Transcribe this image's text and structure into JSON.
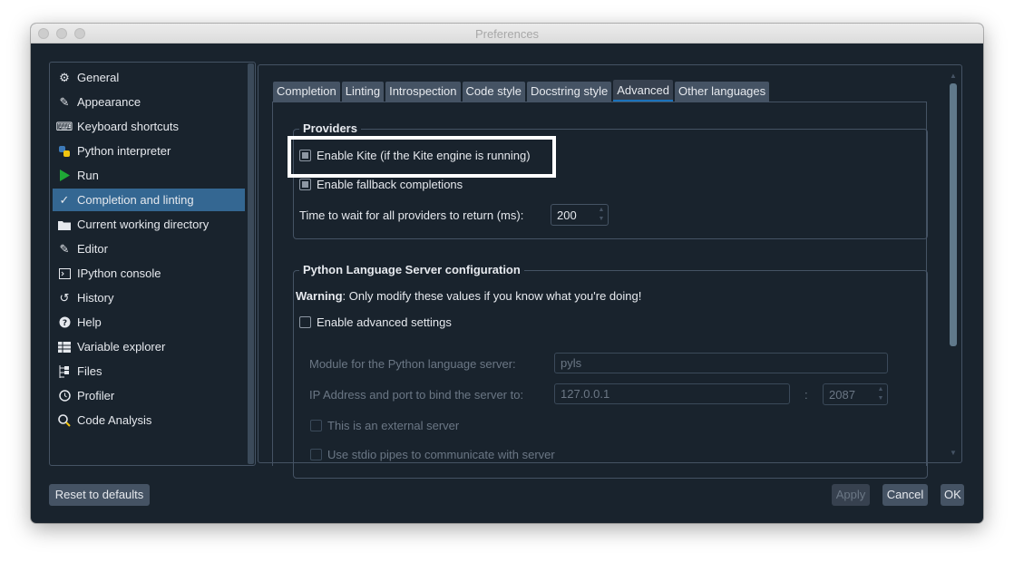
{
  "window": {
    "title": "Preferences"
  },
  "sidebar": {
    "items": [
      {
        "label": "General",
        "icon": "gears-icon"
      },
      {
        "label": "Appearance",
        "icon": "paintbrush-icon"
      },
      {
        "label": "Keyboard shortcuts",
        "icon": "keyboard-icon"
      },
      {
        "label": "Python interpreter",
        "icon": "python-icon"
      },
      {
        "label": "Run",
        "icon": "play-icon"
      },
      {
        "label": "Completion and linting",
        "icon": "completion-icon",
        "selected": true
      },
      {
        "label": "Current working directory",
        "icon": "folder-icon"
      },
      {
        "label": "Editor",
        "icon": "edit-icon"
      },
      {
        "label": "IPython console",
        "icon": "terminal-icon"
      },
      {
        "label": "History",
        "icon": "history-icon"
      },
      {
        "label": "Help",
        "icon": "help-icon"
      },
      {
        "label": "Variable explorer",
        "icon": "table-icon"
      },
      {
        "label": "Files",
        "icon": "files-icon"
      },
      {
        "label": "Profiler",
        "icon": "clock-icon"
      },
      {
        "label": "Code Analysis",
        "icon": "code-analysis-icon"
      }
    ]
  },
  "tabs": [
    {
      "label": "Completion"
    },
    {
      "label": "Linting"
    },
    {
      "label": "Introspection"
    },
    {
      "label": "Code style"
    },
    {
      "label": "Docstring style"
    },
    {
      "label": "Advanced",
      "active": true
    },
    {
      "label": "Other languages"
    }
  ],
  "providers": {
    "title": "Providers",
    "kite_label": "Enable Kite (if the Kite engine is running)",
    "fallback_label": "Enable fallback completions",
    "wait_label": "Time to wait for all providers to return (ms):",
    "wait_value": "200"
  },
  "pls": {
    "title": "Python Language Server configuration",
    "warning_bold": "Warning",
    "warning_text": ": Only modify these values if you know what you're doing!",
    "advanced_label": "Enable advanced settings",
    "module_label": "Module for the Python language server:",
    "module_value": "pyls",
    "ip_label": "IP Address and port to bind the server to:",
    "ip_value": "127.0.0.1",
    "port_sep": ":",
    "port_value": "2087",
    "external_label": "This is an external server",
    "stdio_label": "Use stdio pipes to communicate with server"
  },
  "buttons": {
    "reset": "Reset to defaults",
    "apply": "Apply",
    "cancel": "Cancel",
    "ok": "OK"
  },
  "colors": {
    "background": "#19232d",
    "selection": "#346792",
    "border": "#455364",
    "tab_active_underline": "#1a72bb"
  }
}
